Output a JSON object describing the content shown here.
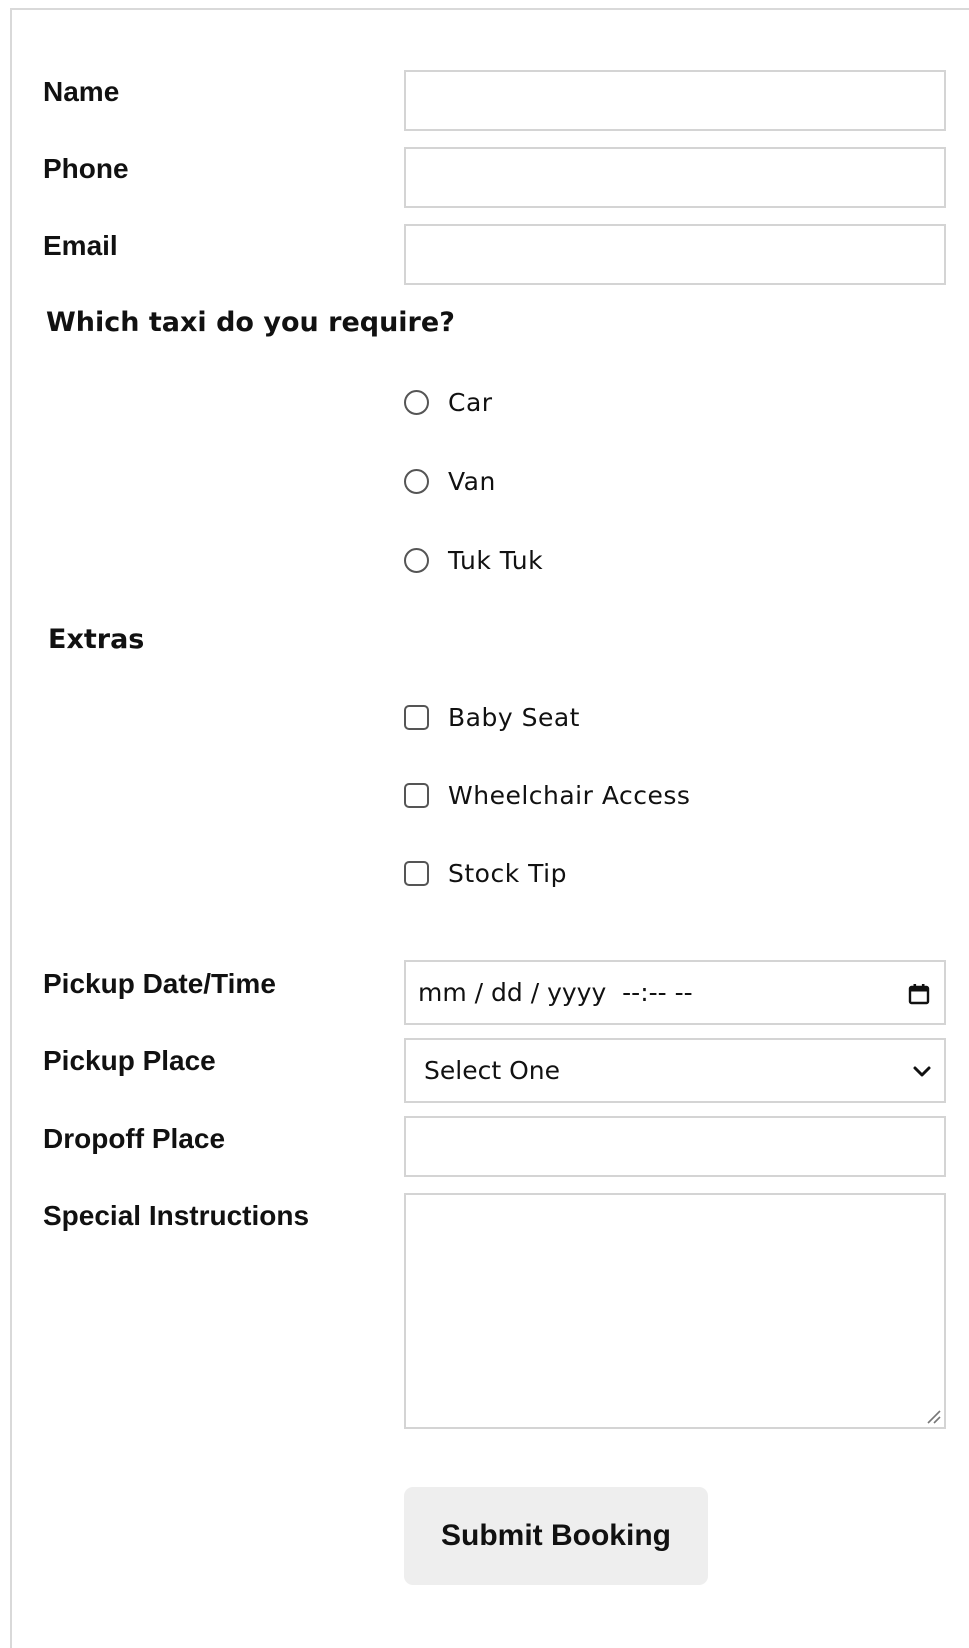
{
  "form": {
    "name": {
      "label": "Name",
      "value": ""
    },
    "phone": {
      "label": "Phone",
      "value": ""
    },
    "email": {
      "label": "Email",
      "value": ""
    },
    "taxi_question": "Which taxi do you require?",
    "taxi_options": [
      "Car",
      "Van",
      "Tuk Tuk"
    ],
    "extras_title": "Extras",
    "extras_options": [
      "Baby Seat",
      "Wheelchair Access",
      "Stock Tip"
    ],
    "pickup_datetime": {
      "label": "Pickup Date/Time",
      "placeholder": "mm / dd / yyyy  --:-- --"
    },
    "pickup_place": {
      "label": "Pickup Place",
      "selected": "Select One"
    },
    "dropoff_place": {
      "label": "Dropoff Place",
      "value": ""
    },
    "special_instructions": {
      "label": "Special Instructions",
      "value": ""
    },
    "submit_label": "Submit Booking"
  }
}
